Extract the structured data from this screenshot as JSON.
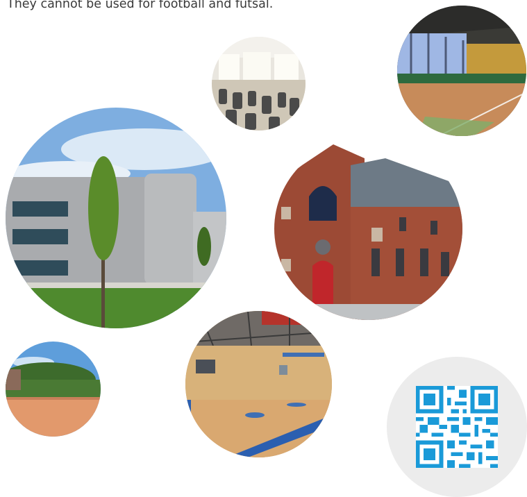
{
  "intro_text": "They cannot be used for football and futsal.",
  "photos": [
    {
      "name": "gym",
      "icon": "fitness-room-photo"
    },
    {
      "name": "tennis-indoor",
      "icon": "indoor-tennis-hall-photo"
    },
    {
      "name": "modern",
      "icon": "modern-sports-building-photo"
    },
    {
      "name": "brick",
      "icon": "historic-brick-building-photo"
    },
    {
      "name": "clay",
      "icon": "outdoor-clay-court-photo"
    },
    {
      "name": "hall",
      "icon": "indoor-sports-hall-photo"
    }
  ],
  "qr": {
    "icon": "qr-code-icon",
    "color": "#1a9ad8"
  },
  "colors": {
    "text": "#3a3a3a",
    "qr_bg": "#ececec",
    "accent_blue": "#1a9ad8"
  }
}
